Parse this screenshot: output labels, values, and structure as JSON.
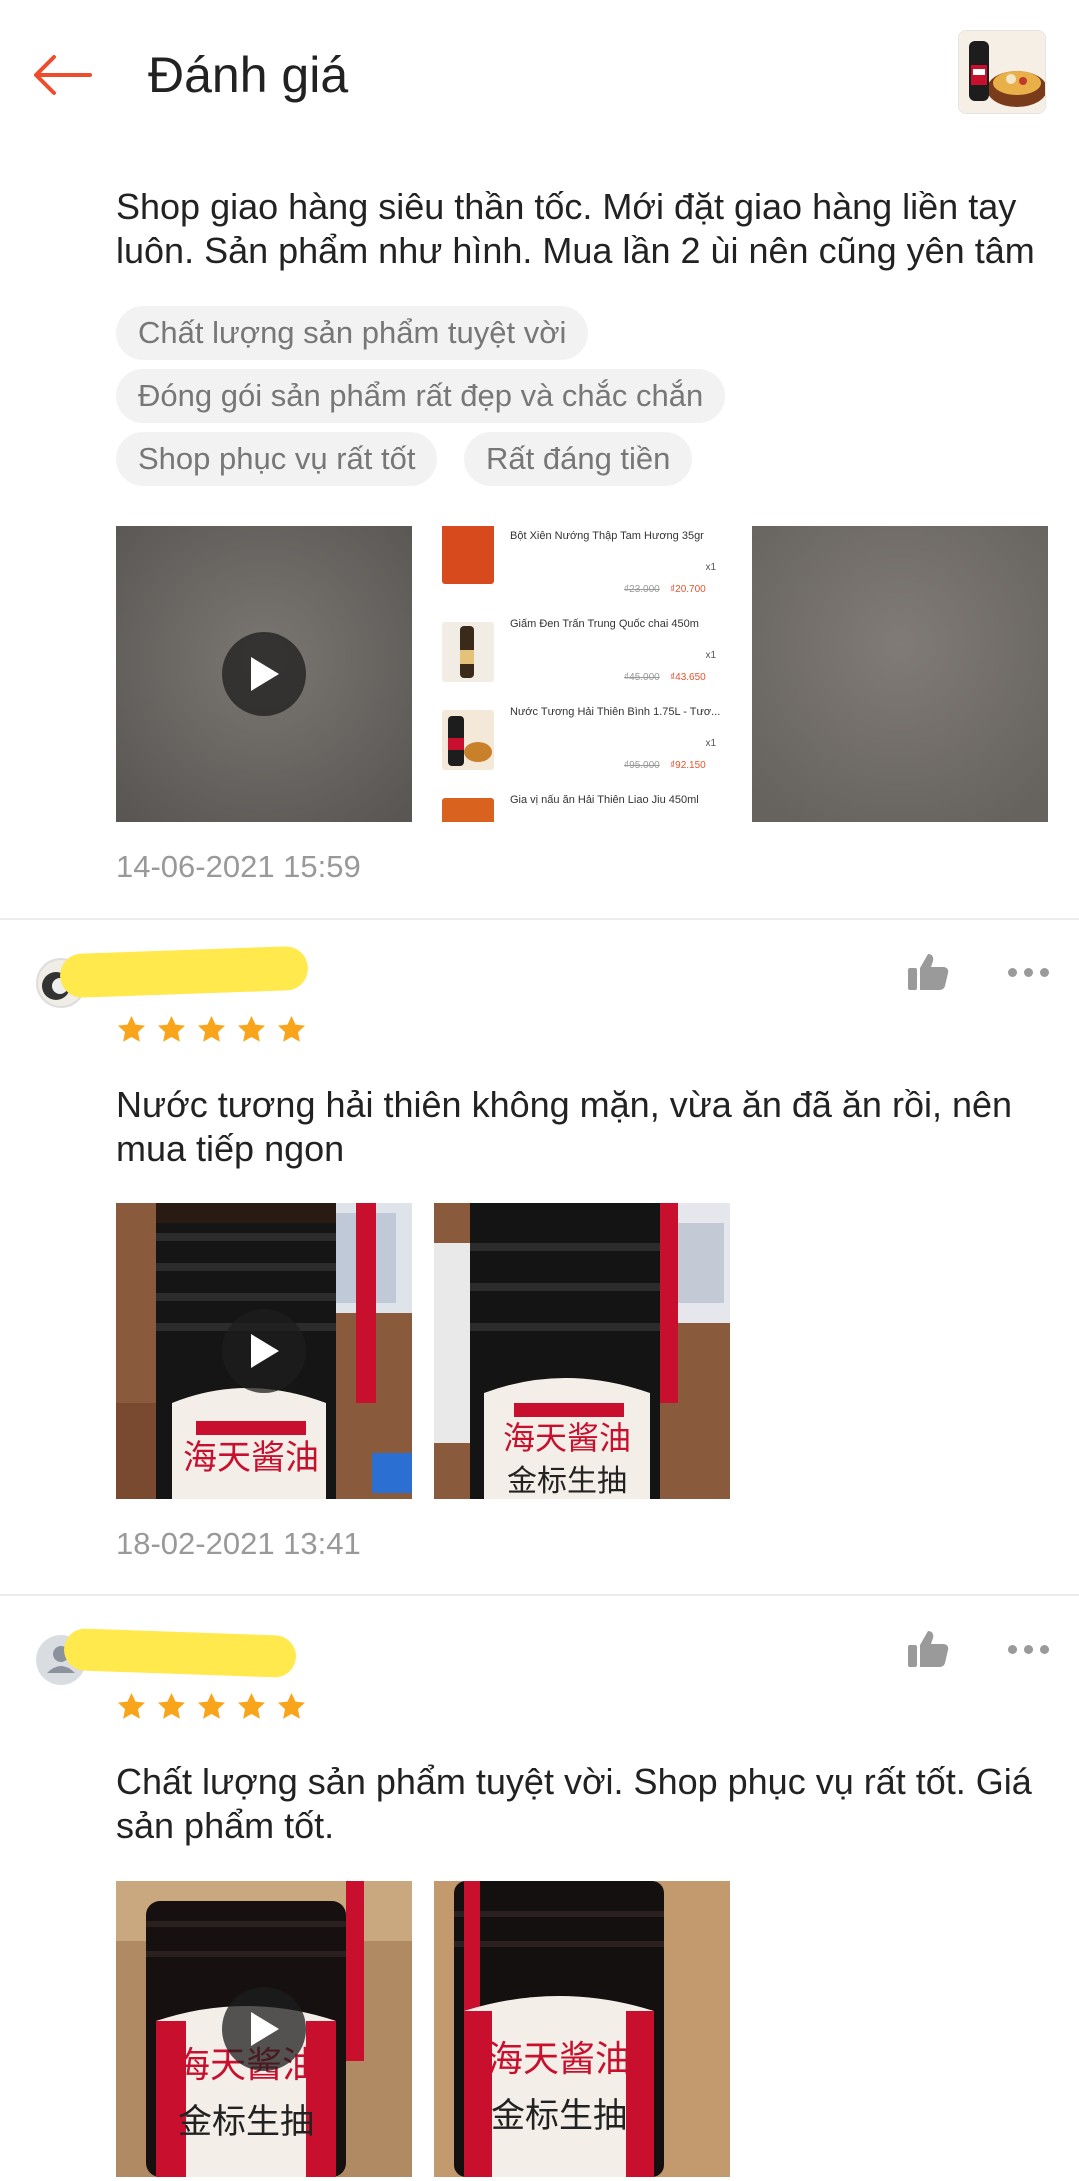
{
  "header": {
    "title": "Đánh giá"
  },
  "reviews": [
    {
      "text": "Shop giao hàng siêu thần tốc. Mới đặt giao hàng liền tay luôn. Sản phẩm như hình. Mua lần 2 ùi nên cũng yên tâm",
      "tags": [
        "Chất lượng sản phẩm tuyệt vời",
        "Đóng gói sản phẩm rất đẹp và chắc chắn",
        "Shop phục vụ rất tốt",
        "Rất đáng tiền"
      ],
      "receipt_items": [
        {
          "name": "Bột Xiên Nướng Thập Tam Hương 35gr",
          "qty": "x1",
          "old_price": "₫23.000",
          "new_price": "₫20.700"
        },
        {
          "name": "Giấm Đen Trấn Trung Quốc chai 450m",
          "qty": "x1",
          "old_price": "₫45.000",
          "new_price": "₫43.650"
        },
        {
          "name": "Nước Tương Hải Thiên Bình 1.75L - Tươ...",
          "qty": "x1",
          "old_price": "₫95.000",
          "new_price": "₫92.150"
        },
        {
          "name": "Gia vị nấu ăn Hải Thiên Liao Jiu 450ml",
          "qty": "",
          "old_price": "",
          "new_price": ""
        }
      ],
      "timestamp": "14-06-2021 15:59"
    },
    {
      "rating": 5,
      "text": "Nước tương hải thiên không mặn, vừa ăn đã ăn rồi, nên mua tiếp ngon",
      "timestamp": "18-02-2021 13:41"
    },
    {
      "rating": 5,
      "text": "Chất lượng sản phẩm tuyệt vời. Shop phục vụ rất tốt. Giá sản phẩm tốt."
    }
  ],
  "bottle_label": "海天酱油",
  "bottle_sub": "金标生抽",
  "colors": {
    "accent": "#ee4d2d",
    "star": "#f8a51c",
    "highlight": "#ffe94d",
    "tag_bg": "#f2f2f2",
    "muted": "#999999"
  }
}
